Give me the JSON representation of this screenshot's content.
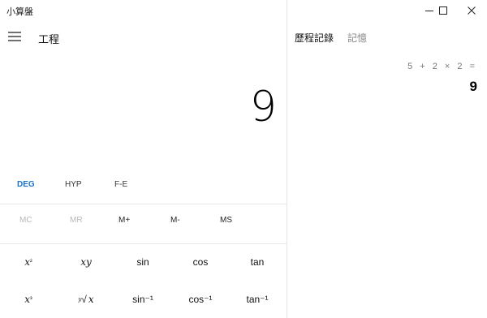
{
  "window": {
    "title": "小算盤"
  },
  "header": {
    "mode_title": "工程"
  },
  "display": {
    "value": "9"
  },
  "modes": {
    "deg": "DEG",
    "hyp": "HYP",
    "fe": "F-E"
  },
  "memory": {
    "mc": "MC",
    "mr": "MR",
    "m_plus": "M+",
    "m_minus": "M-",
    "ms": "MS"
  },
  "keys": {
    "row1": {
      "x_squared_base": "x",
      "x_squared_exp": "²",
      "x_pow_y_base": "x",
      "x_pow_y_exp": "y",
      "sin": "sin",
      "cos": "cos",
      "tan": "tan"
    },
    "row2": {
      "x_cubed_base": "x",
      "x_cubed_exp": "³",
      "y_root_idx": "y",
      "y_root_sym": "√",
      "y_root_x": "x",
      "asin": "sin⁻¹",
      "acos": "cos⁻¹",
      "atan": "tan⁻¹"
    }
  },
  "history_panel": {
    "tab_history": "歷程記錄",
    "tab_memory": "記憶",
    "entry_expression": "5 + 2 × 2 =",
    "entry_result": "9"
  },
  "colors": {
    "accent": "#1a73c8",
    "disabled_text": "#b8b8b8",
    "divider": "#e6e6e6"
  }
}
